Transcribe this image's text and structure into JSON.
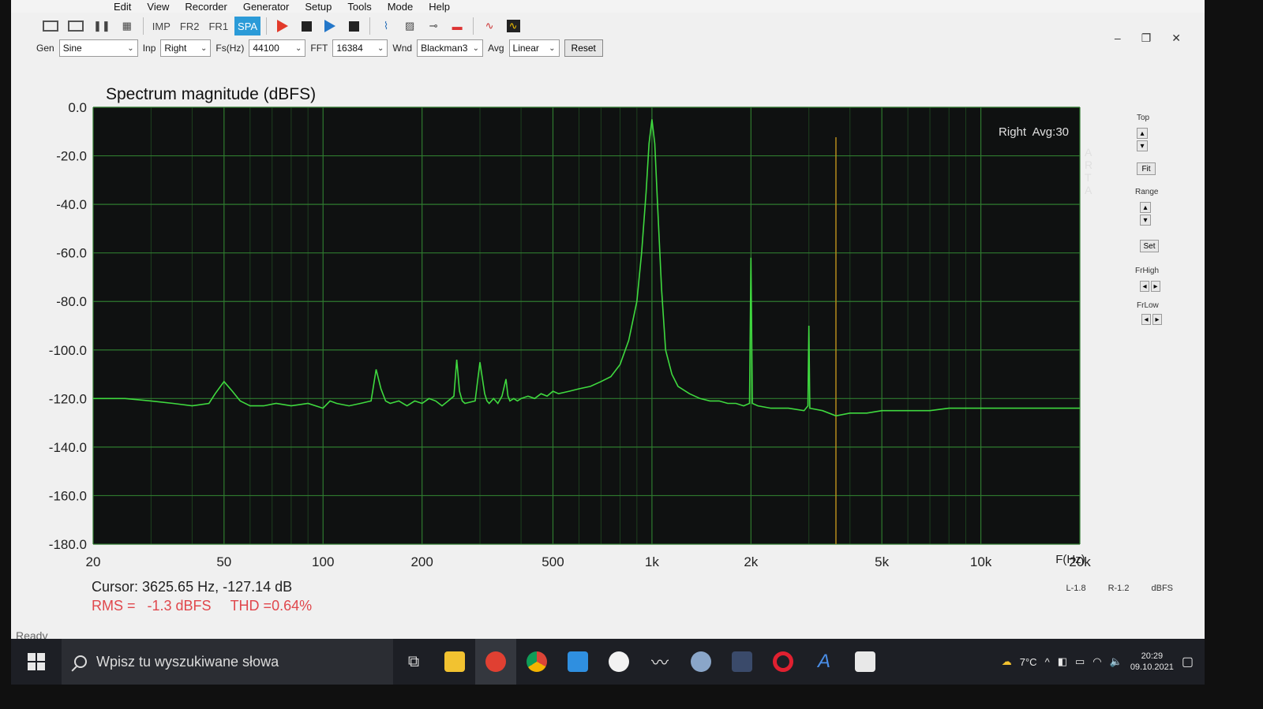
{
  "menu": [
    "Edit",
    "View",
    "Recorder",
    "Generator",
    "Setup",
    "Tools",
    "Mode",
    "Help"
  ],
  "toolbar1": {
    "modes": [
      "IMP",
      "FR2",
      "FR1",
      "SPA"
    ],
    "active_mode": "SPA"
  },
  "toolbar2": {
    "gen_label": "Gen",
    "gen_value": "Sine",
    "inp_label": "Inp",
    "inp_value": "Right",
    "fs_label": "Fs(Hz)",
    "fs_value": "44100",
    "fft_label": "FFT",
    "fft_value": "16384",
    "wnd_label": "Wnd",
    "wnd_value": "Blackman3",
    "avg_label": "Avg",
    "avg_value": "Linear",
    "reset_label": "Reset"
  },
  "window_controls": [
    "–",
    "❐",
    "✕"
  ],
  "plot": {
    "title": "Spectrum magnitude (dBFS)",
    "channel_info": "Right  Avg:30",
    "arta_letters": [
      "A",
      "R",
      "T",
      "A"
    ],
    "x_axis_label": "F(Hz)",
    "colors": {
      "plot_bg": "#0f1111",
      "grid": "#2f7a2f",
      "trace": "#3fd93f",
      "cursor": "#b58a1c"
    }
  },
  "chart_data": {
    "type": "line",
    "title": "Spectrum magnitude (dBFS)",
    "xlabel": "F(Hz)",
    "ylabel": "",
    "xscale": "log",
    "xlim": [
      20,
      20000
    ],
    "ylim": [
      -180,
      0
    ],
    "x_ticks": [
      {
        "value": 20,
        "label": "20"
      },
      {
        "value": 50,
        "label": "50"
      },
      {
        "value": 100,
        "label": "100"
      },
      {
        "value": 200,
        "label": "200"
      },
      {
        "value": 500,
        "label": "500"
      },
      {
        "value": 1000,
        "label": "1k"
      },
      {
        "value": 2000,
        "label": "2k"
      },
      {
        "value": 5000,
        "label": "5k"
      },
      {
        "value": 10000,
        "label": "10k"
      },
      {
        "value": 20000,
        "label": "20k"
      }
    ],
    "y_ticks": [
      {
        "value": 0,
        "label": "0.0"
      },
      {
        "value": -20,
        "label": "-20.0"
      },
      {
        "value": -40,
        "label": "-40.0"
      },
      {
        "value": -60,
        "label": "-60.0"
      },
      {
        "value": -80,
        "label": "-80.0"
      },
      {
        "value": -100,
        "label": "-100.0"
      },
      {
        "value": -120,
        "label": "-120.0"
      },
      {
        "value": -140,
        "label": "-140.0"
      },
      {
        "value": -160,
        "label": "-160.0"
      },
      {
        "value": -180,
        "label": "-180.0"
      }
    ],
    "grid": true,
    "cursor_x": 3625.65,
    "series": [
      {
        "x": [
          20,
          25,
          30,
          35,
          40,
          45,
          47,
          50,
          53,
          56,
          60,
          66,
          72,
          80,
          90,
          100,
          105,
          110,
          120,
          130,
          140,
          145,
          150,
          155,
          160,
          170,
          180,
          190,
          200,
          210,
          220,
          230,
          240,
          250,
          255,
          260,
          265,
          270,
          290,
          300,
          310,
          315,
          320,
          330,
          340,
          350,
          360,
          365,
          370,
          380,
          390,
          400,
          420,
          440,
          460,
          480,
          500,
          520,
          560,
          600,
          650,
          700,
          750,
          800,
          850,
          900,
          930,
          960,
          980,
          1000,
          1020,
          1040,
          1070,
          1100,
          1150,
          1200,
          1300,
          1400,
          1500,
          1600,
          1700,
          1800,
          1900,
          1980,
          2000,
          2020,
          2100,
          2300,
          2600,
          2900,
          2980,
          3000,
          3020,
          3300,
          3625.65,
          4000,
          4500,
          5000,
          5500,
          6000,
          7000,
          8000,
          9000,
          10000,
          11000,
          12000,
          13000,
          14000,
          15000,
          16000,
          17000,
          18000,
          19000,
          20000
        ],
        "y": [
          -120,
          -120,
          -121,
          -122,
          -123,
          -122,
          -118,
          -113,
          -117,
          -121,
          -123,
          -123,
          -122,
          -123,
          -122,
          -124,
          -121,
          -122,
          -123,
          -122,
          -121,
          -108,
          -116,
          -121,
          -122,
          -121,
          -123,
          -121,
          -122,
          -120,
          -121,
          -123,
          -121,
          -119,
          -104,
          -117,
          -121,
          -122,
          -121,
          -105,
          -118,
          -121,
          -122,
          -120,
          -122,
          -119,
          -112,
          -119,
          -121,
          -120,
          -121,
          -120,
          -119,
          -120,
          -118,
          -119,
          -117,
          -118,
          -117,
          -116,
          -115,
          -113,
          -111,
          -106,
          -96,
          -80,
          -60,
          -35,
          -15,
          -5,
          -15,
          -40,
          -75,
          -100,
          -110,
          -115,
          -118,
          -120,
          -121,
          -121,
          -122,
          -122,
          -123,
          -122,
          -62,
          -122,
          -123,
          -124,
          -124,
          -125,
          -123,
          -90,
          -124,
          -125,
          -127.14,
          -126,
          -126,
          -125,
          -125,
          -125,
          -125,
          -124,
          -124,
          -124,
          -124,
          -124,
          -124,
          -124,
          -124,
          -124,
          -124,
          -124,
          -124,
          -124
        ]
      }
    ]
  },
  "right_panel": {
    "top_label": "Top",
    "fit_label": "Fit",
    "range_label": "Range",
    "set_label": "Set",
    "frhigh_label": "FrHigh",
    "frlow_label": "FrLow"
  },
  "readouts": {
    "cursor": "Cursor: 3625.65 Hz, -127.14 dB",
    "rms": "RMS =   -1.3 dBFS",
    "thd": "THD =0.64%",
    "status": "Ready",
    "l_value": "L-1.8",
    "r_value": "R-1.2",
    "unit": "dBFS"
  },
  "taskbar": {
    "search_placeholder": "Wpisz tu wyszukiwane słowa",
    "weather": "7°C",
    "time": "20:29",
    "date": "09.10.2021"
  }
}
